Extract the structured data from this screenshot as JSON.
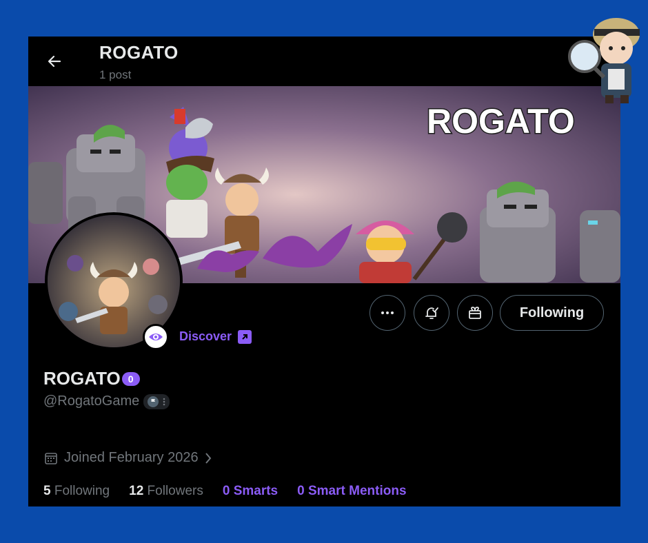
{
  "header": {
    "title": "ROGATO",
    "post_count": "1 post"
  },
  "banner": {
    "logo_text": "ROGATO"
  },
  "discover": {
    "label": "Discover"
  },
  "actions": {
    "following_label": "Following"
  },
  "profile": {
    "name": "ROGATO",
    "name_badge": "0",
    "handle": "@RogatoGame",
    "joined": "Joined February 2026"
  },
  "stats": {
    "following_count": "5",
    "following_label": "Following",
    "followers_count": "12",
    "followers_label": "Followers",
    "smarts": "0 Smarts",
    "smart_mentions": "0 Smart Mentions"
  },
  "icons": {
    "back": "arrow-left-icon",
    "more": "more-icon",
    "notify": "bell-check-icon",
    "gift": "gift-icon",
    "calendar": "calendar-icon",
    "discover": "eye-icon",
    "external": "arrow-up-right-icon",
    "flag": "flag-icon"
  },
  "colors": {
    "page_bg": "#0a4bab",
    "panel_bg": "#000000",
    "accent": "#8b5cf6",
    "muted": "#71767b",
    "text": "#e7e9ea"
  }
}
